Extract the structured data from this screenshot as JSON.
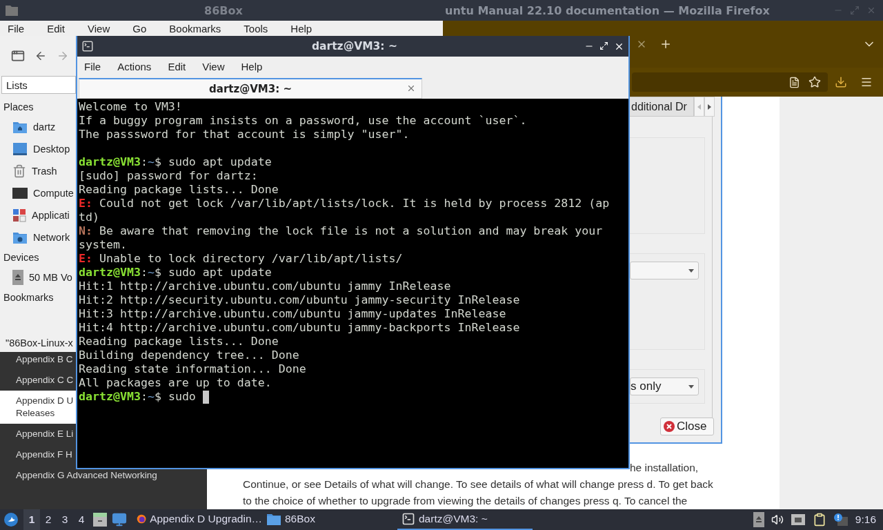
{
  "browser": {
    "title": "untu Manual 22.10 documentation — Mozilla Firefox",
    "toc": [
      {
        "label": "Appendix B C",
        "selected": false
      },
      {
        "label": "Appendix C C",
        "selected": false
      },
      {
        "label": "Appendix D U\nReleases",
        "selected": true
      },
      {
        "label": "Appendix E Li",
        "selected": false
      },
      {
        "label": "Appendix F H",
        "selected": false
      },
      {
        "label": "Appendix G Advanced Networking",
        "selected": false
      }
    ],
    "body_lines": [
      "he installation,",
      "Continue, or see Details of what will change. To see details of what will change press d. To get back",
      "to the choice of whether to upgrade from viewing the details of changes press q. To cancel the"
    ]
  },
  "file_manager": {
    "title": "86Box",
    "menu": [
      "File",
      "Edit",
      "View",
      "Go",
      "Bookmarks",
      "Tools",
      "Help"
    ],
    "view_mode": "Lists",
    "sections": [
      {
        "heading": "Places",
        "items": [
          {
            "label": "dartz"
          },
          {
            "label": "Desktop"
          },
          {
            "label": "Trash"
          },
          {
            "label": "Compute"
          },
          {
            "label": "Applicati"
          },
          {
            "label": "Network"
          }
        ]
      },
      {
        "heading": "Devices",
        "items": [
          {
            "label": "50 MB Vo"
          }
        ]
      },
      {
        "heading": "Bookmarks"
      }
    ],
    "status": "\"86Box-Linux-x"
  },
  "settings_dialog": {
    "tab": "dditional Dr",
    "dropdown_2": "s only",
    "close_button": "Close"
  },
  "terminal": {
    "title": "dartz@VM3: ~",
    "menu": [
      "File",
      "Actions",
      "Edit",
      "View",
      "Help"
    ],
    "tabs": [
      {
        "label": "dartz@VM3: ~",
        "selected": true
      }
    ],
    "lines": [
      {
        "segments": [
          {
            "kind": "plain",
            "text": "Welcome to VM3!"
          }
        ]
      },
      {
        "segments": [
          {
            "kind": "plain",
            "text": "If a buggy program insists on a password, use the account `user`."
          }
        ]
      },
      {
        "segments": [
          {
            "kind": "plain",
            "text": "The passsword for that account is simply \"user\"."
          }
        ]
      },
      {
        "kind": "blank"
      },
      {
        "segments": [
          {
            "kind": "user",
            "text": "dartz@VM3"
          },
          {
            "kind": "plain",
            "text": ":"
          },
          {
            "kind": "path",
            "text": "~"
          },
          {
            "kind": "plain",
            "text": "$ sudo apt update"
          }
        ]
      },
      {
        "segments": [
          {
            "kind": "plain",
            "text": "[sudo] password for dartz:"
          }
        ]
      },
      {
        "segments": [
          {
            "kind": "plain",
            "text": "Reading package lists... Done"
          }
        ]
      },
      {
        "segments": [
          {
            "kind": "error",
            "text": "E:"
          },
          {
            "kind": "plain",
            "text": " Could not get lock /var/lib/apt/lists/lock. It is held by process 2812 (ap"
          }
        ]
      },
      {
        "segments": [
          {
            "kind": "plain",
            "text": "td)"
          }
        ]
      },
      {
        "segments": [
          {
            "kind": "notice",
            "text": "N:"
          },
          {
            "kind": "plain",
            "text": " Be aware that removing the lock file is not a solution and may break your"
          }
        ]
      },
      {
        "segments": [
          {
            "kind": "plain",
            "text": "system."
          }
        ]
      },
      {
        "segments": [
          {
            "kind": "error",
            "text": "E:"
          },
          {
            "kind": "plain",
            "text": " Unable to lock directory /var/lib/apt/lists/"
          }
        ]
      },
      {
        "segments": [
          {
            "kind": "user",
            "text": "dartz@VM3"
          },
          {
            "kind": "plain",
            "text": ":"
          },
          {
            "kind": "path",
            "text": "~"
          },
          {
            "kind": "plain",
            "text": "$ sudo apt update"
          }
        ]
      },
      {
        "segments": [
          {
            "kind": "plain",
            "text": "Hit:1 http://archive.ubuntu.com/ubuntu jammy InRelease"
          }
        ]
      },
      {
        "segments": [
          {
            "kind": "plain",
            "text": "Hit:2 http://security.ubuntu.com/ubuntu jammy-security InRelease"
          }
        ]
      },
      {
        "segments": [
          {
            "kind": "plain",
            "text": "Hit:3 http://archive.ubuntu.com/ubuntu jammy-updates InRelease"
          }
        ]
      },
      {
        "segments": [
          {
            "kind": "plain",
            "text": "Hit:4 http://archive.ubuntu.com/ubuntu jammy-backports InRelease"
          }
        ]
      },
      {
        "segments": [
          {
            "kind": "plain",
            "text": "Reading package lists... Done"
          }
        ]
      },
      {
        "segments": [
          {
            "kind": "plain",
            "text": "Building dependency tree... Done"
          }
        ]
      },
      {
        "segments": [
          {
            "kind": "plain",
            "text": "Reading state information... Done"
          }
        ]
      },
      {
        "segments": [
          {
            "kind": "plain",
            "text": "All packages are up to date."
          }
        ]
      },
      {
        "segments": [
          {
            "kind": "user",
            "text": "dartz@VM3"
          },
          {
            "kind": "plain",
            "text": ":"
          },
          {
            "kind": "path",
            "text": "~"
          },
          {
            "kind": "plain",
            "text": "$ sudo "
          }
        ],
        "cursor": true
      }
    ]
  },
  "taskbar": {
    "workspaces": [
      {
        "label": "1",
        "selected": true
      },
      {
        "label": "2",
        "selected": false
      },
      {
        "label": "3",
        "selected": false
      },
      {
        "label": "4",
        "selected": false
      }
    ],
    "tasks": [
      {
        "label": "Appendix D Upgradin…",
        "selected": false
      },
      {
        "label": "86Box",
        "selected": false
      },
      {
        "label": "dartz@VM3: ~",
        "selected": true
      }
    ],
    "clock": "9:16"
  }
}
